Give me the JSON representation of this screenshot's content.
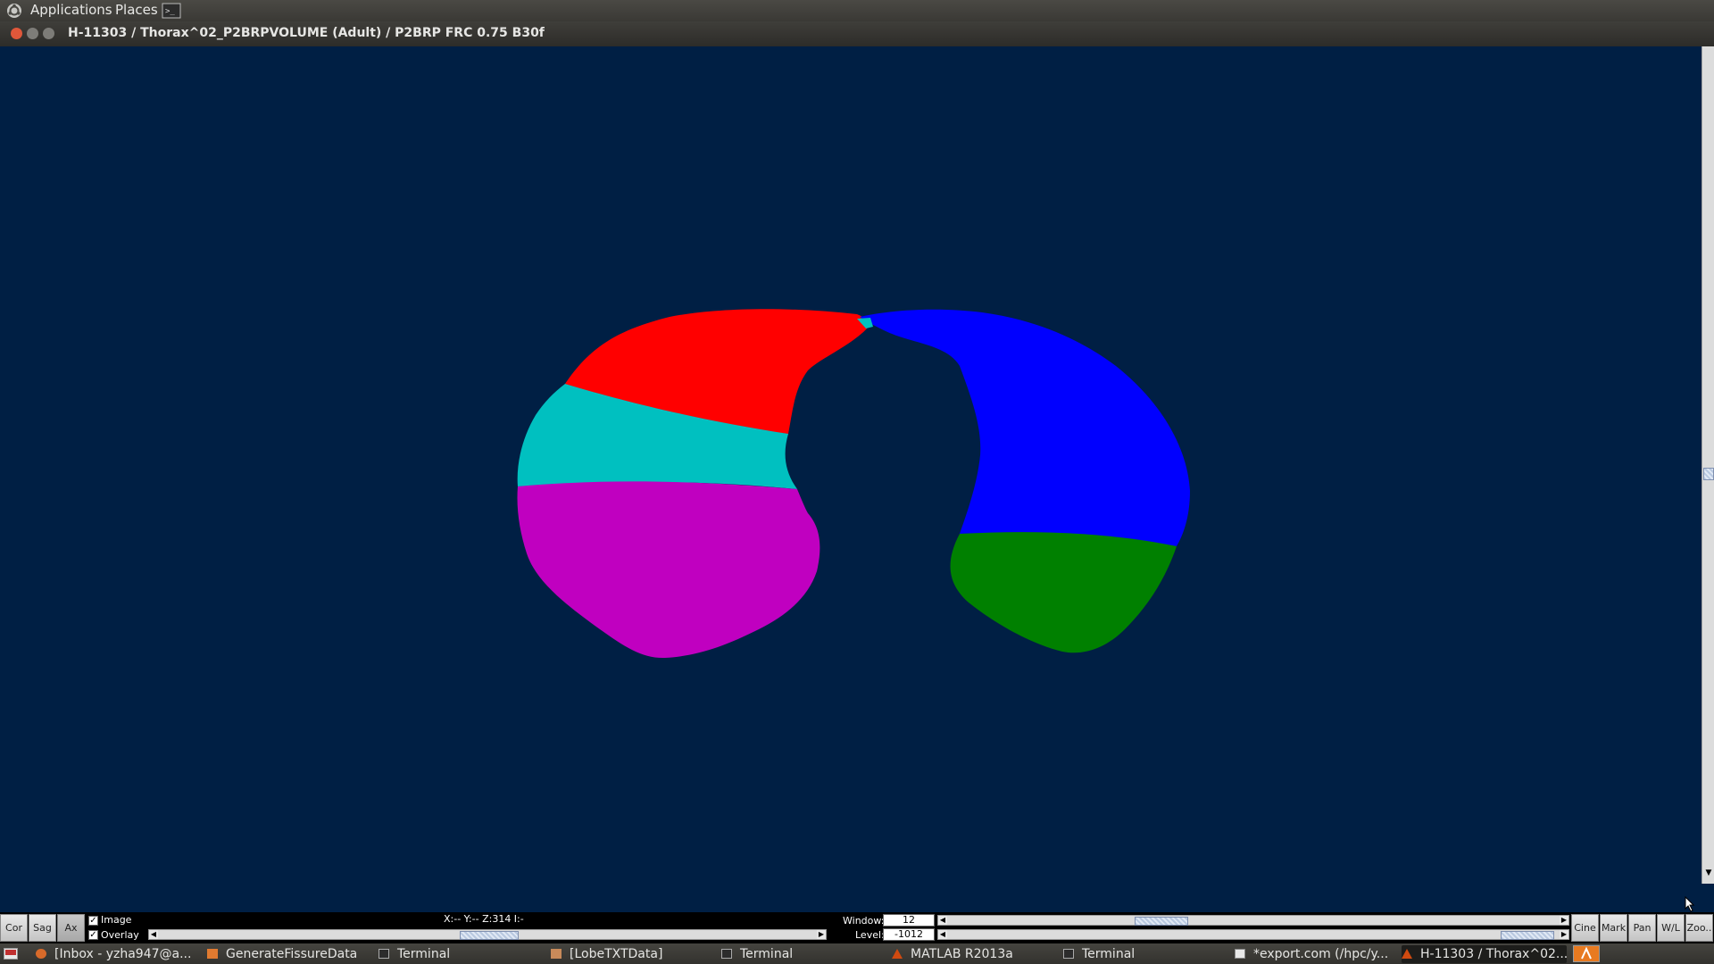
{
  "top_panel": {
    "menus": [
      "Applications",
      "Places"
    ]
  },
  "window": {
    "title": "H-11303 / Thorax^02_P2BRPVOLUME (Adult) / P2BRP FRC 0.75  B30f"
  },
  "viewer": {
    "background": "#001f44",
    "lobe_colors": {
      "right_upper": "#ff0000",
      "right_middle": "#00c0c0",
      "right_lower": "#c000c0",
      "left_upper": "#0000ff",
      "left_lower": "#008000"
    }
  },
  "controls": {
    "view_buttons": [
      "Cor",
      "Sag",
      "Ax"
    ],
    "active_view": "Ax",
    "checkboxes": [
      {
        "label": "Image",
        "checked": true
      },
      {
        "label": "Overlay",
        "checked": true
      }
    ],
    "coords": "X:-- Y:-- Z:314 I:-",
    "window_label": "Window:",
    "window_value": "12",
    "level_label": "Level:",
    "level_value": "-1012",
    "tool_buttons": [
      "Cine",
      "Mark",
      "Pan",
      "W/L",
      "Zoo.."
    ]
  },
  "taskbar": {
    "items": [
      {
        "label": "[Inbox - yzha947@a...",
        "icon": "thunderbird-icon"
      },
      {
        "label": "GenerateFissureData",
        "icon": "folder-icon"
      },
      {
        "label": "Terminal",
        "icon": "terminal-icon"
      },
      {
        "label": "[LobeTXTData]",
        "icon": "folder-icon"
      },
      {
        "label": "Terminal",
        "icon": "terminal-icon"
      },
      {
        "label": "MATLAB R2013a",
        "icon": "matlab-icon"
      },
      {
        "label": "Terminal",
        "icon": "terminal-icon"
      },
      {
        "label": "*export.com (/hpc/y...",
        "icon": "text-editor-icon"
      },
      {
        "label": "H-11303 / Thorax^02...",
        "icon": "matlab-icon"
      }
    ]
  }
}
